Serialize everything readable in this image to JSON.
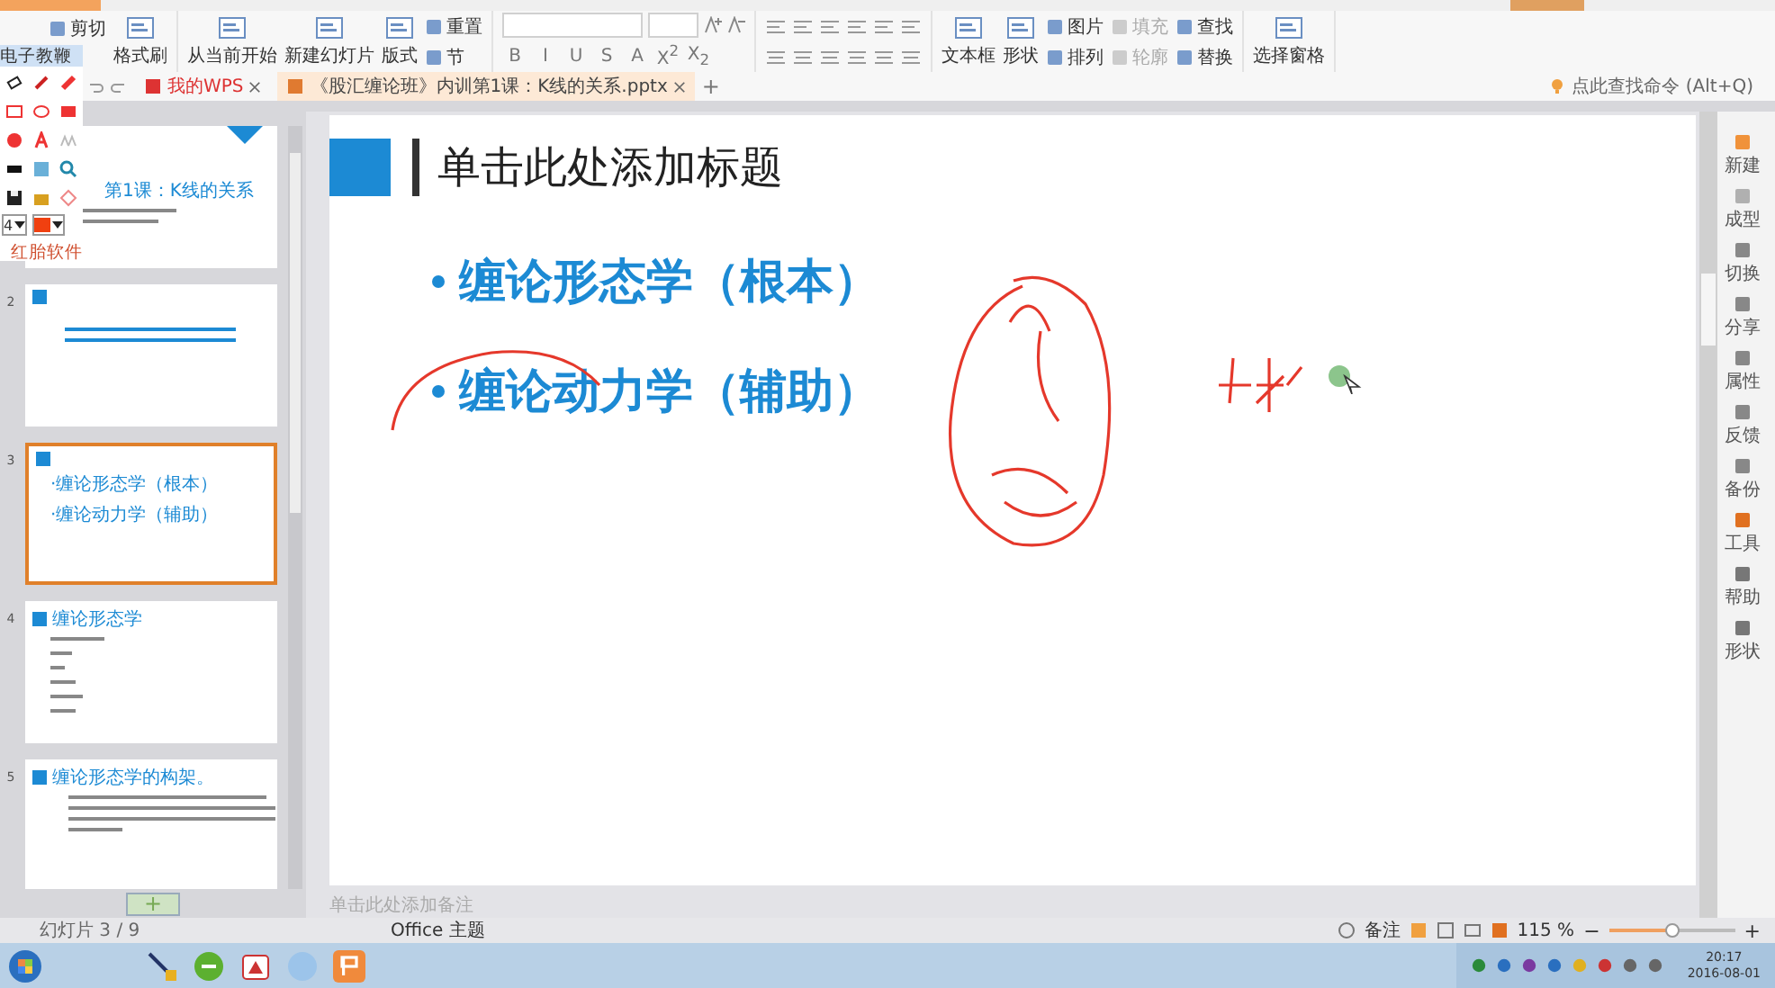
{
  "ribbon": {
    "groups": [
      {
        "columns": [
          [
            {
              "kind": "small",
              "label": "剪切",
              "disabled": false
            }
          ],
          [
            {
              "kind": "large",
              "label": "格式刷",
              "disabled": false
            }
          ]
        ]
      },
      {
        "columns": [
          [
            {
              "kind": "large",
              "label": "从当前开始",
              "disabled": false
            }
          ],
          [
            {
              "kind": "large",
              "label": "新建幻灯片",
              "disabled": false
            }
          ],
          [
            {
              "kind": "large",
              "label": "版式",
              "disabled": false
            }
          ],
          [
            {
              "kind": "small",
              "label": "重置",
              "disabled": false
            },
            {
              "kind": "small",
              "label": "节",
              "disabled": false
            }
          ]
        ]
      },
      {
        "columns": [
          [
            {
              "kind": "fonts"
            },
            {
              "kind": "glyphs",
              "glyphs": [
                "B",
                "I",
                "U",
                "S",
                "A",
                "X$^{2}$",
                "X$_{2}$"
              ]
            }
          ]
        ]
      },
      {
        "columns": [
          [
            {
              "kind": "paragraph"
            }
          ]
        ]
      },
      {
        "columns": [
          [
            {
              "kind": "large",
              "label": "文本框",
              "disabled": false
            }
          ],
          [
            {
              "kind": "large",
              "label": "形状",
              "disabled": false
            }
          ],
          [
            {
              "kind": "small",
              "label": "图片",
              "disabled": false
            },
            {
              "kind": "small",
              "label": "排列",
              "disabled": false
            }
          ],
          [
            {
              "kind": "small",
              "label": "填充",
              "disabled": true
            },
            {
              "kind": "small",
              "label": "轮廓",
              "disabled": true
            }
          ],
          [
            {
              "kind": "small",
              "label": "查找",
              "disabled": false
            },
            {
              "kind": "small",
              "label": "替换",
              "disabled": false
            }
          ]
        ]
      },
      {
        "columns": [
          [
            {
              "kind": "large",
              "label": "选择窗格",
              "disabled": false
            }
          ]
        ]
      }
    ]
  },
  "pen_palette": {
    "title": "电子教鞭",
    "size": "4",
    "footer": "红胎软件"
  },
  "doc_tabs": [
    {
      "label": "我的WPS",
      "selected": false
    },
    {
      "label": "《股汇缠论班》内训第1课：K线的关系.pptx",
      "selected": true
    }
  ],
  "new_tab": "+",
  "command_search": {
    "placeholder": "点此查找命令 (Alt+Q)"
  },
  "slides": [
    {
      "kind": "title",
      "selected": false,
      "title": "第1课：K线的关系"
    },
    {
      "number": "2",
      "kind": "text",
      "selected": false
    },
    {
      "number": "3",
      "kind": "bullets",
      "selected": true,
      "bullets": [
        "·缠论形态学（根本）",
        "·缠论动力学（辅助）"
      ]
    },
    {
      "number": "4",
      "kind": "list",
      "selected": false,
      "title": "缠论形态学"
    },
    {
      "number": "5",
      "kind": "paragraph",
      "selected": false,
      "title": "缠论形态学的构架。"
    }
  ],
  "add_slide": "+",
  "slide": {
    "title": "单击此处添加标题",
    "bullets": [
      "缠论形态学（根本）",
      "缠论动力学（辅助）"
    ]
  },
  "notes": {
    "placeholder": "单击此处添加备注"
  },
  "right_sidebar": [
    {
      "label": "新建"
    },
    {
      "label": "成型"
    },
    {
      "label": "切换"
    },
    {
      "label": "分享"
    },
    {
      "label": "属性"
    },
    {
      "label": "反馈"
    },
    {
      "label": "备份"
    },
    {
      "label": "工具"
    },
    {
      "label": "帮助"
    },
    {
      "label": "形状"
    }
  ],
  "status_bar": {
    "slide_counter": "幻灯片 3 / 9",
    "theme": "Office 主题",
    "notes_button": "备注",
    "zoom": "115 %",
    "zoom_minus": "−",
    "zoom_plus": "+",
    "zoom_slider": {
      "level": 0.5
    }
  },
  "taskbar": {
    "time": "20:17",
    "date": "2016-08-01"
  }
}
